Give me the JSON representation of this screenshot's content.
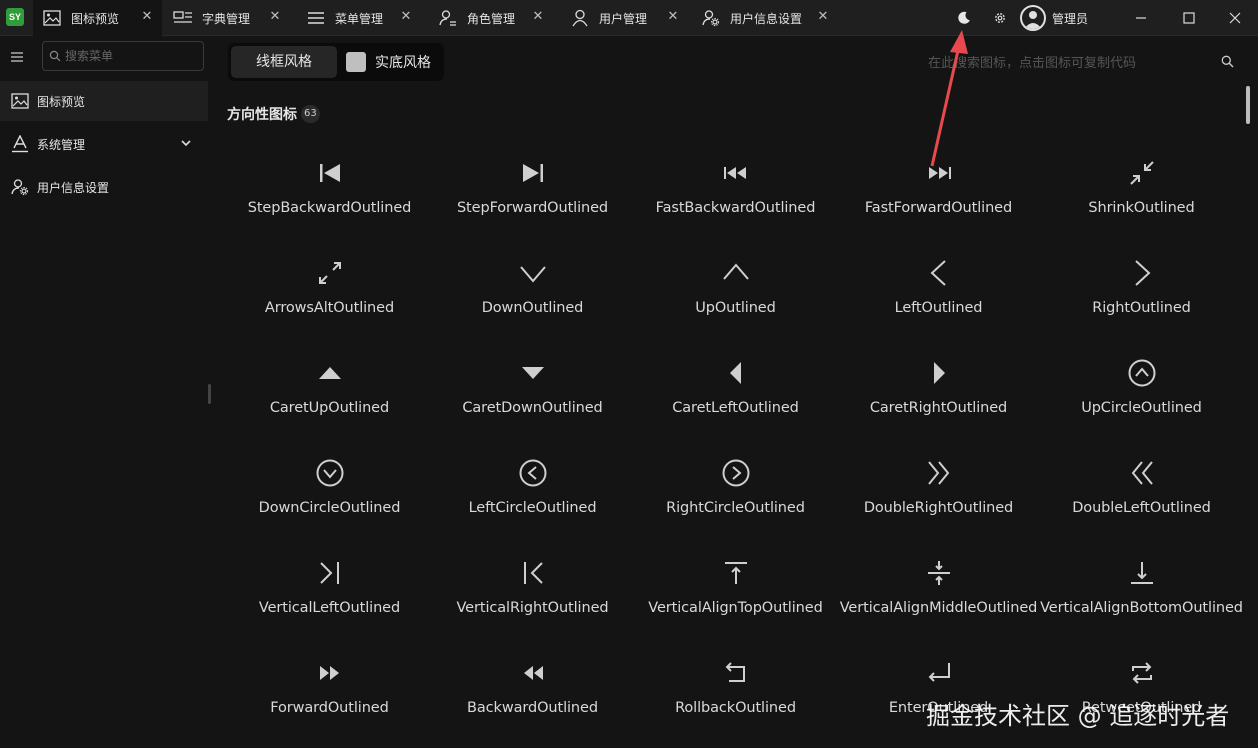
{
  "app": {
    "logo_text": "SY",
    "theme_toggle_icon": "moon-icon",
    "settings_icon": "gear-icon",
    "user_name": "管理员",
    "colors": {
      "background": "#141414",
      "titlebar": "#1f1f1f",
      "logo": "#2e9d3a",
      "annotation_arrow": "#e8494f"
    }
  },
  "tabs": [
    {
      "label": "图标预览",
      "icon": "image-icon",
      "active": true
    },
    {
      "label": "字典管理",
      "icon": "dictionary-icon",
      "active": false
    },
    {
      "label": "菜单管理",
      "icon": "menu-icon",
      "active": false
    },
    {
      "label": "角色管理",
      "icon": "role-icon",
      "active": false
    },
    {
      "label": "用户管理",
      "icon": "user-icon",
      "active": false
    },
    {
      "label": "用户信息设置",
      "icon": "user-settings-icon",
      "active": false
    }
  ],
  "sidebar": {
    "search_placeholder": "搜索菜单",
    "items": [
      {
        "label": "图标预览",
        "icon": "image-icon",
        "active": true
      },
      {
        "label": "系统管理",
        "icon": "font-icon",
        "expandable": true
      },
      {
        "label": "用户信息设置",
        "icon": "user-settings-icon"
      }
    ]
  },
  "content": {
    "style_options": {
      "outlined": "线框风格",
      "filled": "实底风格",
      "selected": "outlined"
    },
    "search_hint": "在此搜索图标，点击图标可复制代码",
    "section": {
      "title": "方向性图标",
      "count": "63"
    },
    "icons": [
      {
        "name": "StepBackwardOutlined",
        "glyph": "step-backward"
      },
      {
        "name": "StepForwardOutlined",
        "glyph": "step-forward"
      },
      {
        "name": "FastBackwardOutlined",
        "glyph": "fast-backward"
      },
      {
        "name": "FastForwardOutlined",
        "glyph": "fast-forward"
      },
      {
        "name": "ShrinkOutlined",
        "glyph": "shrink"
      },
      {
        "name": "ArrowsAltOutlined",
        "glyph": "arrows-alt"
      },
      {
        "name": "DownOutlined",
        "glyph": "down"
      },
      {
        "name": "UpOutlined",
        "glyph": "up"
      },
      {
        "name": "LeftOutlined",
        "glyph": "left"
      },
      {
        "name": "RightOutlined",
        "glyph": "right"
      },
      {
        "name": "CaretUpOutlined",
        "glyph": "caret-up"
      },
      {
        "name": "CaretDownOutlined",
        "glyph": "caret-down"
      },
      {
        "name": "CaretLeftOutlined",
        "glyph": "caret-left"
      },
      {
        "name": "CaretRightOutlined",
        "glyph": "caret-right"
      },
      {
        "name": "UpCircleOutlined",
        "glyph": "up-circle"
      },
      {
        "name": "DownCircleOutlined",
        "glyph": "down-circle"
      },
      {
        "name": "LeftCircleOutlined",
        "glyph": "left-circle"
      },
      {
        "name": "RightCircleOutlined",
        "glyph": "right-circle"
      },
      {
        "name": "DoubleRightOutlined",
        "glyph": "double-right"
      },
      {
        "name": "DoubleLeftOutlined",
        "glyph": "double-left"
      },
      {
        "name": "VerticalLeftOutlined",
        "glyph": "vertical-left"
      },
      {
        "name": "VerticalRightOutlined",
        "glyph": "vertical-right"
      },
      {
        "name": "VerticalAlignTopOutlined",
        "glyph": "vertical-align-top"
      },
      {
        "name": "VerticalAlignMiddleOutlined",
        "glyph": "vertical-align-middle"
      },
      {
        "name": "VerticalAlignBottomOutlined",
        "glyph": "vertical-align-bottom"
      },
      {
        "name": "ForwardOutlined",
        "glyph": "forward"
      },
      {
        "name": "BackwardOutlined",
        "glyph": "backward"
      },
      {
        "name": "RollbackOutlined",
        "glyph": "rollback"
      },
      {
        "name": "EnterOutlined",
        "glyph": "enter"
      },
      {
        "name": "RetweetOutlined",
        "glyph": "retweet"
      }
    ]
  },
  "watermark": "掘金技术社区 @ 追逐时光者"
}
